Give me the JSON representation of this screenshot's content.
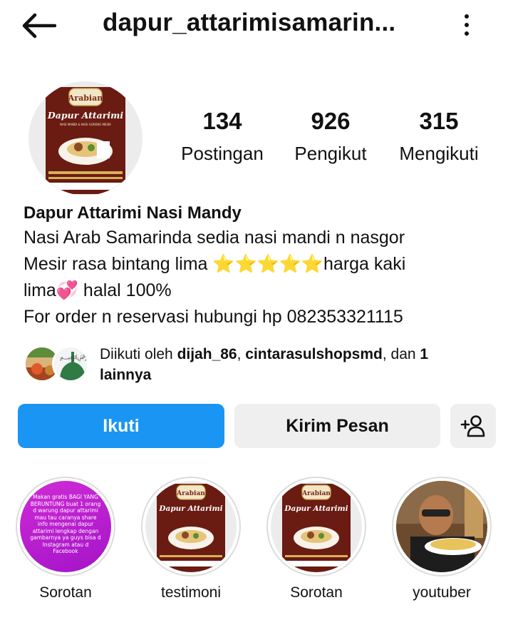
{
  "header": {
    "username": "dapur_attarimisamarin..."
  },
  "profile": {
    "avatar_icon": "logo-image",
    "logo_badge": "Arabian",
    "logo_title": "Dapur Attarimi",
    "logo_subtitle": "NASI MANDI & NASI GORENG MESIR"
  },
  "stats": [
    {
      "value": "134",
      "label": "Postingan"
    },
    {
      "value": "926",
      "label": "Pengikut"
    },
    {
      "value": "315",
      "label": "Mengikuti"
    }
  ],
  "bio": {
    "name": "Dapur Attarimi Nasi Mandy",
    "line1": "Nasi Arab Samarinda sedia nasi mandi n nasgor",
    "line2": "Mesir rasa bintang lima ⭐⭐⭐⭐⭐harga kaki",
    "line3": "lima💞 halal 100%",
    "line4": "For order n reservasi hubungi hp 082353321115"
  },
  "mutual": {
    "prefix": "Diikuti oleh ",
    "user1": "dijah_86",
    "sep": ", ",
    "user2": "cintarasulshopsmd",
    "suffix": ", dan ",
    "count": "1",
    "more": "lainnya"
  },
  "actions": {
    "follow": "Ikuti",
    "message": "Kirim Pesan",
    "add_user_icon": "add-user-icon"
  },
  "highlights": [
    {
      "label": "Sorotan",
      "promo_text": "Makan gratis BAGI YANG BERUNTUNG buat 1 orang d warung dapur attarimi mau tau caranya share info mengenai dapur attarimi lengkap dengan gambarnya ya guys bisa d Instagram atau d Facebook"
    },
    {
      "label": "testimoni"
    },
    {
      "label": "Sorotan"
    },
    {
      "label": "youtuber"
    }
  ],
  "colors": {
    "primary": "#1a95f4",
    "secondary_button": "#efefef",
    "logo_bg": "#6a1b12"
  }
}
